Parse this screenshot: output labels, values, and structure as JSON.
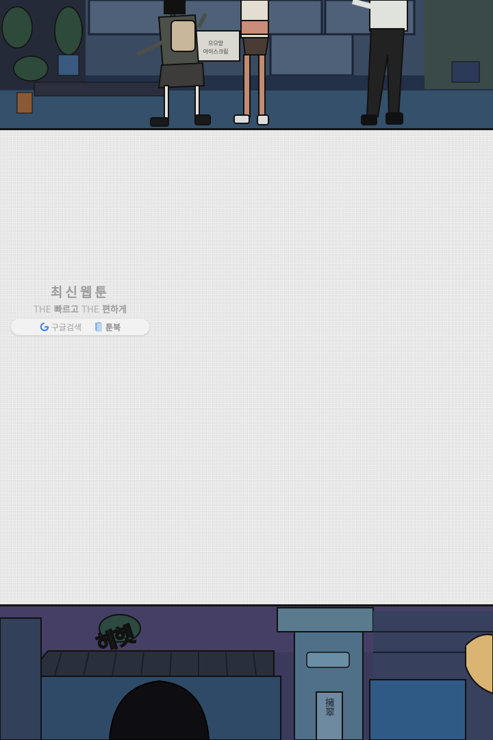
{
  "watermark": {
    "title": "최신웹툰",
    "tagline": {
      "the_1": "THE",
      "word_1": "빠르고",
      "the_2": "THE",
      "word_2": "편하게"
    },
    "search": {
      "icon": "google-g-icon",
      "label": "구글검색"
    },
    "book": {
      "icon": "book-icon",
      "label": "툰북"
    }
  },
  "top_panel": {
    "sign_lines": [
      "으으앙",
      "아이스크림"
    ]
  },
  "bottom_panel": {
    "sfx": "헤헷",
    "sign_chars": "擁翠"
  },
  "colors": {
    "paper": "#eaeaea",
    "night_sky": "#2e3148",
    "panel_border": "#141414",
    "watermark_text": "#9a9a9a"
  }
}
